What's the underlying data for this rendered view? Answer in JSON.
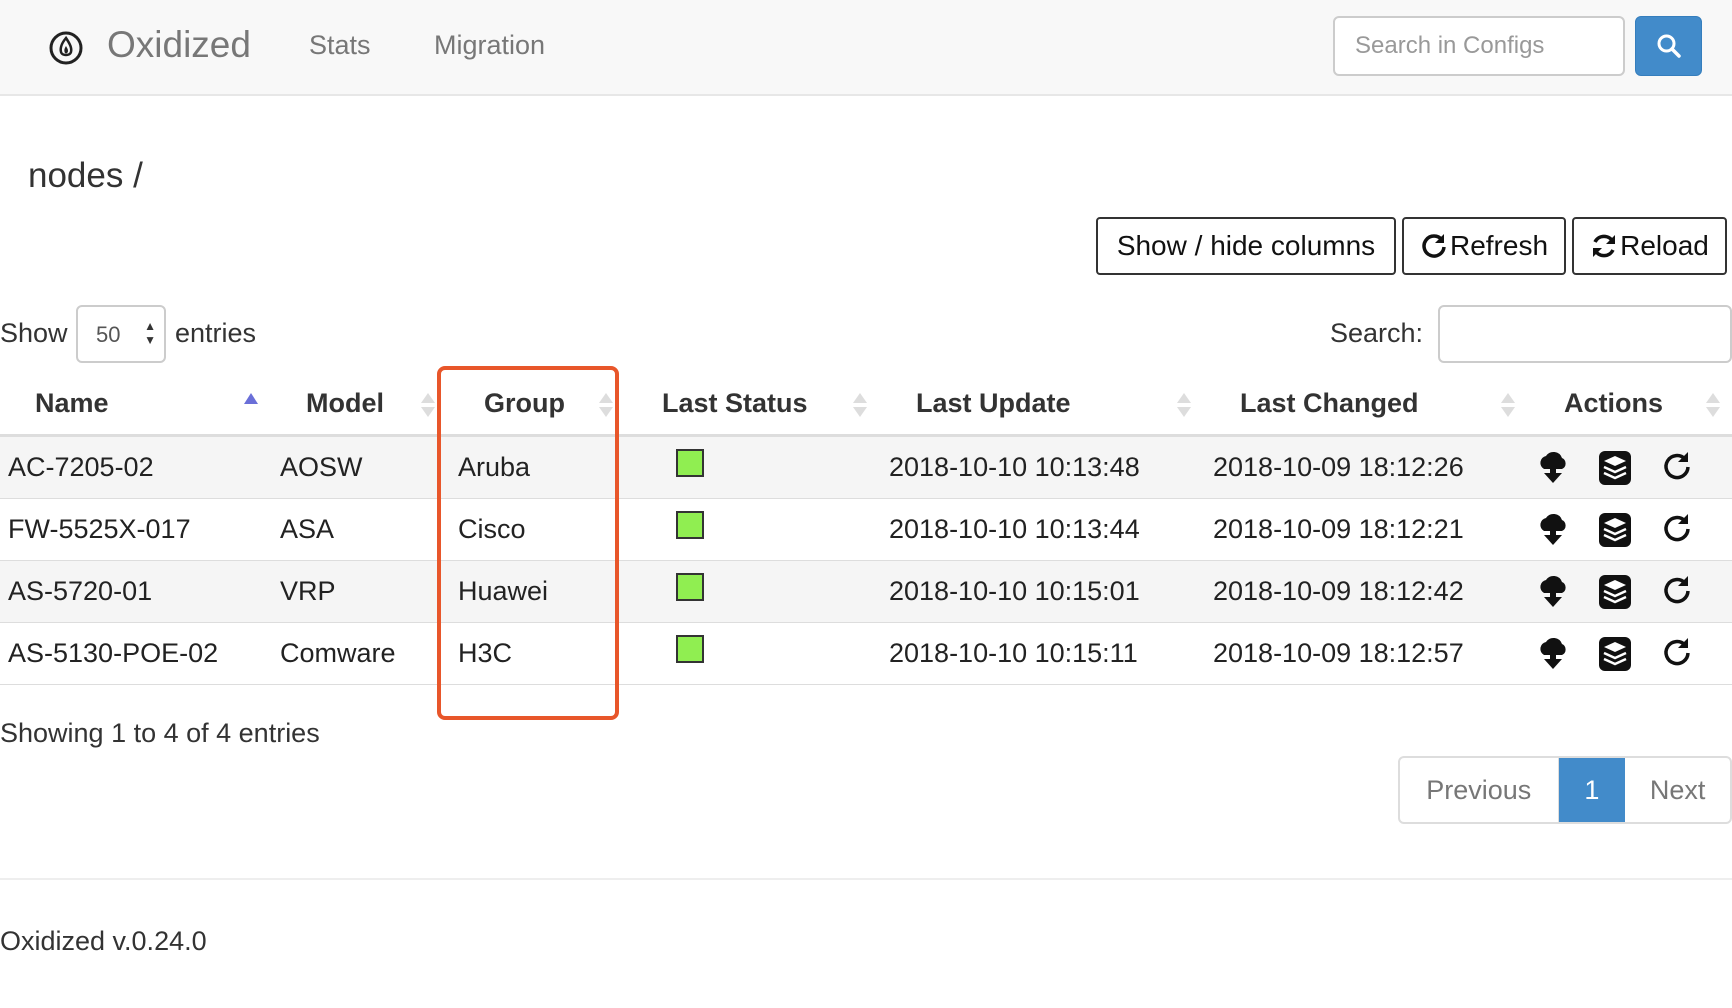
{
  "navbar": {
    "brand": "Oxidized",
    "links": [
      "Stats",
      "Migration"
    ],
    "search_placeholder": "Search in Configs"
  },
  "page_title": "nodes /",
  "toolbar": {
    "show_hide": "Show / hide columns",
    "refresh": "Refresh",
    "reload": "Reload"
  },
  "length": {
    "show": "Show",
    "value": "50",
    "entries": "entries"
  },
  "filter": {
    "label": "Search:"
  },
  "table": {
    "headers": [
      "Name",
      "Model",
      "Group",
      "Last Status",
      "Last Update",
      "Last Changed",
      "Actions"
    ],
    "rows": [
      {
        "name": "AC-7205-02",
        "model": "AOSW",
        "group": "Aruba",
        "status": "ok",
        "last_update": "2018-10-10 10:13:48",
        "last_changed": "2018-10-09 18:12:26"
      },
      {
        "name": "FW-5525X-017",
        "model": "ASA",
        "group": "Cisco",
        "status": "ok",
        "last_update": "2018-10-10 10:13:44",
        "last_changed": "2018-10-09 18:12:21"
      },
      {
        "name": "AS-5720-01",
        "model": "VRP",
        "group": "Huawei",
        "status": "ok",
        "last_update": "2018-10-10 10:15:01",
        "last_changed": "2018-10-09 18:12:42"
      },
      {
        "name": "AS-5130-POE-02",
        "model": "Comware",
        "group": "H3C",
        "status": "ok",
        "last_update": "2018-10-10 10:15:11",
        "last_changed": "2018-10-09 18:12:57"
      }
    ]
  },
  "info": "Showing 1 to 4 of 4 entries",
  "pagination": {
    "previous": "Previous",
    "current": "1",
    "next": "Next"
  },
  "footer": "Oxidized v.0.24.0",
  "colors": {
    "primary": "#428bca",
    "status_ok": "#90ee51",
    "highlight": "#e8562a"
  }
}
